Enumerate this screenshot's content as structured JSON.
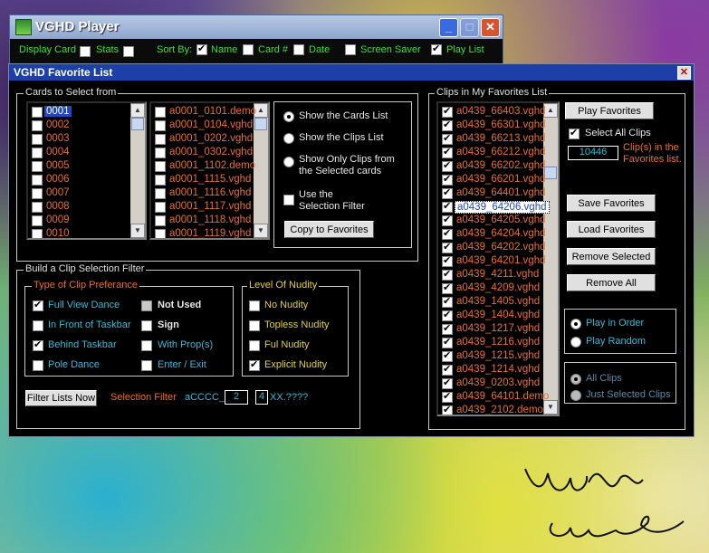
{
  "player": {
    "title": "VGHD Player",
    "display_card": "Display Card",
    "stats": "Stats",
    "sort_by": "Sort By:",
    "name": "Name",
    "card_num": "Card #",
    "date": "Date",
    "screen_saver": "Screen Saver",
    "play_list": "Play List"
  },
  "fav": {
    "title": "VGHD Favorite List",
    "cards_group": "Cards to Select from",
    "cards": [
      "0001",
      "0002",
      "0003",
      "0004",
      "0005",
      "0006",
      "0007",
      "0008",
      "0009",
      "0010"
    ],
    "clips": [
      "a0001_0101.demo",
      "a0001_0104.vghd",
      "a0001_0202.vghd",
      "a0001_0302.vghd",
      "a0001_1102.demo",
      "a0001_1115.vghd",
      "a0001_1116.vghd",
      "a0001_1117.vghd",
      "a0001_1118.vghd",
      "a0001_1119.vghd"
    ],
    "show_cards": "Show the Cards List",
    "show_clips": "Show the Clips List",
    "show_only_1": "Show Only Clips from",
    "show_only_2": "the Selected cards",
    "use_filter_1": "Use the",
    "use_filter_2": "Selection Filter",
    "copy_btn": "Copy to Favorites",
    "filter_group": "Build a Clip Selection Filter",
    "type_group": "Type of Clip Preferance",
    "types": {
      "full_view": "Full View Dance",
      "in_front": "In Front of Taskbar",
      "behind": "Behind Taskbar",
      "pole": "Pole Dance",
      "not_used": "Not Used",
      "sign": "Sign",
      "with_props": "With Prop(s)",
      "enter_exit": "Enter / Exit"
    },
    "nudity_group": "Level Of Nudity",
    "nudity": {
      "no": "No Nudity",
      "topless": "Topless Nudity",
      "full": "Ful Nudity",
      "explicit": "Explicit Nudity"
    },
    "filter_now_btn": "Filter Lists Now",
    "selection_filter": "Selection Filter",
    "filter_prefix": "aCCCC_",
    "filter_val1": "2",
    "filter_val2": "4",
    "filter_suffix": "XX.????",
    "my_clips_group": "Clips in My Favorites List",
    "my_clips": [
      "a0439_66403.vghd",
      "a0439_66301.vghd",
      "a0439_66213.vghd",
      "a0439_66212.vghd",
      "a0439_66202.vghd",
      "a0439_66201.vghd",
      "a0439_64401.vghd",
      "a0439_64206.vghd",
      "a0439_64205.vghd",
      "a0439_64204.vghd",
      "a0439_64202.vghd",
      "a0439_64201.vghd",
      "a0439_4211.vghd",
      "a0439_4209.vghd",
      "a0439_1405.vghd",
      "a0439_1404.vghd",
      "a0439_1217.vghd",
      "a0439_1216.vghd",
      "a0439_1215.vghd",
      "a0439_1214.vghd",
      "a0439_0203.vghd",
      "a0439_64101.demo",
      "a0439_2102.demo"
    ],
    "play_fav_btn": "Play Favorites",
    "select_all": "Select All Clips",
    "count": "10446",
    "count_label_1": "Clip(s) in the",
    "count_label_2": "Favorites list.",
    "save_btn": "Save Favorites",
    "load_btn": "Load Favorites",
    "remove_sel_btn": "Remove Selected",
    "remove_all_btn": "Remove All",
    "play_order": "Play in Order",
    "play_random": "Play Random",
    "all_clips": "All Clips",
    "just_selected": "Just Selected Clips"
  },
  "colors": {
    "accent": "#1c3fa8",
    "text_orange": "#e87030",
    "text_cyan": "#3ab8d8",
    "text_green": "#3ae03a"
  }
}
